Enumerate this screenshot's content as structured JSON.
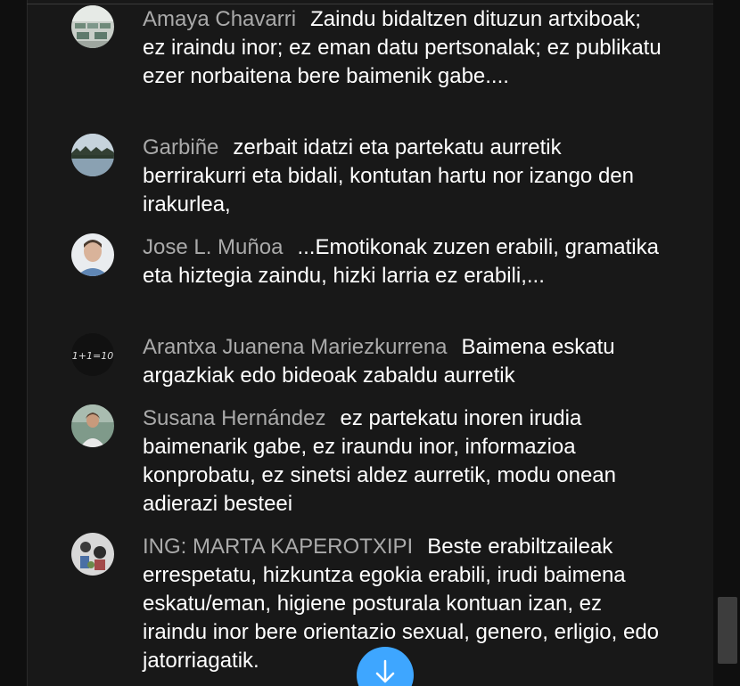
{
  "comments": [
    {
      "author": "Amaya Chavarri",
      "message": "Zaindu bidaltzen dituzun artxiboak; ez iraindu inor; ez eman datu pertsonalak; ez publikatu ezer norbaitena bere baimenik gabe...."
    },
    {
      "author": "Garbiñe",
      "message": "zerbait idatzi eta partekatu aurretik berrirakurri eta bidali, kontutan hartu nor izango den irakurlea,"
    },
    {
      "author": "Jose L. Muñoa",
      "message": "...Emotikonak zuzen erabili, gramatika eta hiztegia zaindu, hizki larria ez erabili,..."
    },
    {
      "author": "Arantxa Juanena Mariezkurrena",
      "avatar_text": "1+1=10",
      "message": "Baimena eskatu argazkiak edo bideoak zabaldu aurretik"
    },
    {
      "author": "Susana Hernández",
      "message": "ez partekatu inoren irudia baimenarik gabe, ez iraundu inor, informazioa konprobatu, ez sinetsi aldez aurretik, modu onean adierazi besteei"
    },
    {
      "author": "ING: MARTA KAPEROTXIPI",
      "message": "Beste erabiltzaileak errespetatu, hizkuntza egokia erabili, irudi baimena eskatu/eman, higiene posturala kontuan izan, ez iraindu inor bere orientazio sexual, genero, erligio, edo jatorriagatik."
    }
  ],
  "colors": {
    "author": "#aaaaaa",
    "message": "#ffffff",
    "panel": "#181818",
    "scroll_button": "#3ea6ff"
  },
  "scroll_button_icon": "arrow-down-icon"
}
